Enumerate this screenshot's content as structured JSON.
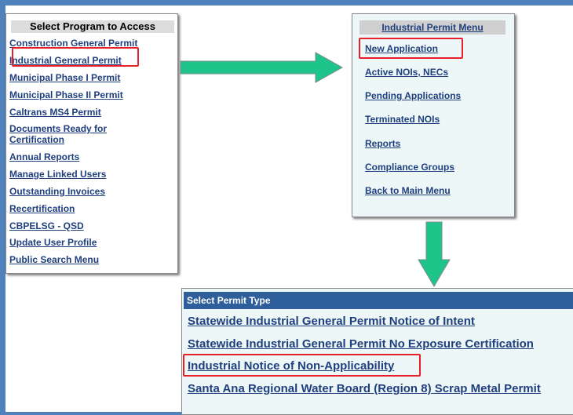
{
  "program_panel": {
    "header": "Select Program to Access",
    "items": [
      "Construction General Permit",
      "Industrial General Permit",
      "Municipal Phase I Permit",
      "Municipal Phase II Permit",
      "Caltrans MS4 Permit",
      "Documents Ready for",
      "Certification",
      "Annual Reports",
      "Manage Linked Users",
      "Outstanding Invoices",
      "Recertification",
      "CBPELSG - QSD",
      "Update User Profile",
      "Public Search Menu"
    ],
    "highlighted": "Industrial General Permit"
  },
  "industrial_menu": {
    "header": "Industrial Permit Menu",
    "items": [
      "New Application",
      "Active NOIs, NECs",
      "Pending Applications",
      "Terminated NOIs",
      "Reports",
      "Compliance Groups",
      "Back to Main Menu"
    ],
    "highlighted": "New Application"
  },
  "permit_type": {
    "header": "Select Permit Type",
    "items": [
      "Statewide Industrial General Permit Notice of Intent",
      "Statewide Industrial General Permit No Exposure Certification",
      "Industrial Notice of Non-Applicability",
      "Santa Ana Regional Water Board (Region 8) Scrap Metal Permit"
    ],
    "highlighted": "Industrial Notice of Non-Applicability"
  },
  "colors": {
    "frame": "#4f81bd",
    "highlight_border": "#e8202a",
    "arrow_fill": "#1fc48a",
    "link": "#1f3f7f",
    "permit_header_bg": "#2e5f9a"
  }
}
